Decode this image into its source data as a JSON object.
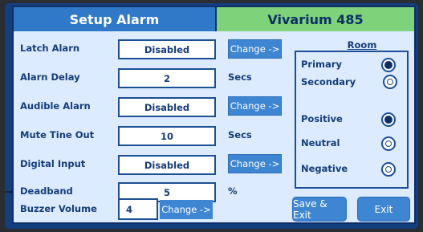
{
  "header": {
    "title": "Setup Alarm",
    "device": "Vivarium 485"
  },
  "settings": [
    {
      "label": "Latch Alarn",
      "value": "Disabled",
      "action": "Change ->"
    },
    {
      "label": "Alarn Delay",
      "value": "2",
      "unit": "Secs"
    },
    {
      "label": "Audible Alarn",
      "value": "Disabled",
      "action": "Change ->"
    },
    {
      "label": "Mute Tine Out",
      "value": "10",
      "unit": "Secs"
    },
    {
      "label": "Digital Input",
      "value": "Disabled",
      "action": "Change ->"
    },
    {
      "label": "Deadband",
      "value": "5",
      "unit": "%"
    }
  ],
  "buzzer": {
    "label": "Buzzer Volume",
    "value": "4",
    "action": "Change ->"
  },
  "room": {
    "title": "Room",
    "options": [
      {
        "label": "Primary",
        "selected": true
      },
      {
        "label": "Secondary",
        "selected": false
      },
      {
        "label": "Positive",
        "selected": true
      },
      {
        "label": "Neutral",
        "selected": false
      },
      {
        "label": "Negative",
        "selected": false
      }
    ]
  },
  "buttons": {
    "save": "Save & Exit",
    "exit": "Exit"
  },
  "colors": {
    "header_left": "#2f79c8",
    "header_right": "#7ed27a",
    "panel": "#dcebff",
    "button": "#3f86d2",
    "text": "#153c78"
  }
}
